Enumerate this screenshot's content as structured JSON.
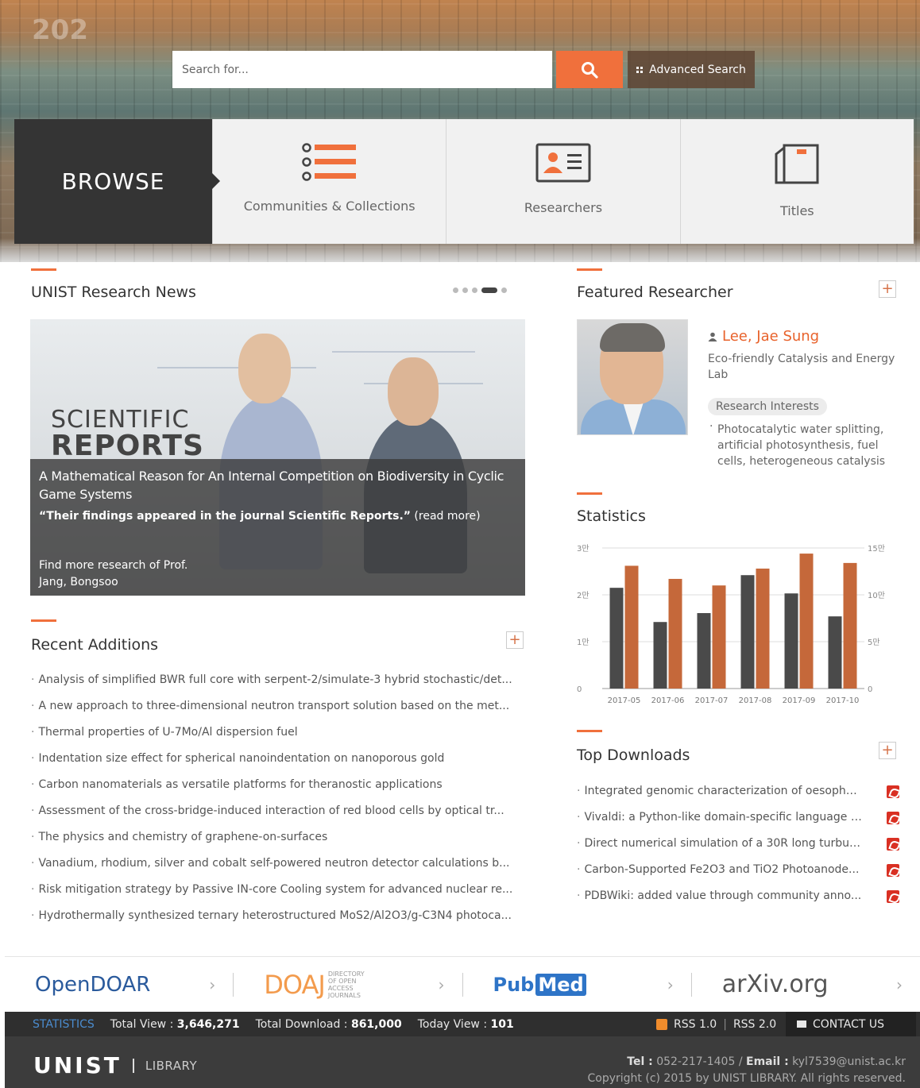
{
  "hero": {
    "decor_number": "202"
  },
  "search": {
    "placeholder": "Search for...",
    "advanced_label": "Advanced Search"
  },
  "browse": {
    "title": "BROWSE",
    "items": [
      {
        "label": "Communities & Collections",
        "icon": "list-icon"
      },
      {
        "label": "Researchers",
        "icon": "contact-card-icon"
      },
      {
        "label": "Titles",
        "icon": "book-icon"
      }
    ]
  },
  "news": {
    "title": "UNIST Research News",
    "slide_count": 5,
    "active_slide": 4,
    "logo_line1": "SCIENTIFIC",
    "logo_line2": "REPORTS",
    "headline": "A Mathematical Reason for An Internal Competition on Biodiversity in Cyclic Game Systems",
    "quote": "“Their findings appeared in the journal Scientific Reports.”",
    "read_more": "(read more)",
    "more_line1": "Find more research of Prof.",
    "more_line2": "Jang, Bongsoo"
  },
  "recent": {
    "title": "Recent Additions",
    "items": [
      "Analysis of simplified BWR full core with serpent-2/simulate-3 hybrid stochastic/det...",
      "A new approach to three-dimensional neutron transport solution based on the met...",
      "Thermal properties of U-7Mo/Al dispersion fuel",
      "Indentation size effect for spherical nanoindentation on nanoporous gold",
      "Carbon nanomaterials as versatile platforms for theranostic applications",
      "Assessment of the cross-bridge-induced interaction of red blood cells by optical tr...",
      "The physics and chemistry of graphene-on-surfaces",
      "Vanadium, rhodium, silver and cobalt self-powered neutron detector calculations b...",
      "Risk mitigation strategy by Passive IN-core Cooling system for advanced nuclear re...",
      "Hydrothermally synthesized ternary heterostructured MoS2/Al2O3/g-C3N4 photoca..."
    ]
  },
  "featured": {
    "title": "Featured Researcher",
    "name": "Lee, Jae Sung",
    "lab": "Eco-friendly Catalysis and Energy Lab",
    "interests_label": "Research Interests",
    "interests": "Photocatalytic water splitting, artificial photosynthesis, fuel cells, heterogeneous catalysis"
  },
  "statistics": {
    "title": "Statistics"
  },
  "chart_data": {
    "type": "bar",
    "categories": [
      "2017-05",
      "2017-06",
      "2017-07",
      "2017-08",
      "2017-09",
      "2017-10"
    ],
    "series": [
      {
        "values": [
          21500,
          14200,
          16100,
          24200,
          20300,
          15400
        ],
        "axis": "left",
        "color": "#4a4a4a"
      },
      {
        "values": [
          131000,
          117000,
          110000,
          128000,
          144000,
          134000
        ],
        "axis": "right",
        "color": "#c5683a"
      }
    ],
    "y_left_ticks": [
      "0",
      "1만",
      "2만",
      "3만"
    ],
    "y_left_range": [
      0,
      30000
    ],
    "y_right_ticks": [
      "0",
      "5만",
      "10만",
      "15만"
    ],
    "y_right_range": [
      0,
      150000
    ],
    "grid": true
  },
  "downloads": {
    "title": "Top Downloads",
    "items": [
      "Integrated genomic characterization of oesopha...",
      "Vivaldi: a Python-like domain-specific language f...",
      "Direct numerical simulation of a 30R long turbul...",
      "Carbon-Supported Fe2O3 and TiO2 Photoanode...",
      "PDBWiki: added value through community anno..."
    ]
  },
  "partners": {
    "opendoar_a": "Open",
    "opendoar_b": "DOAR",
    "doaj": "DOAJ",
    "doaj_sub": "DIRECTORY OF OPEN ACCESS JOURNALS",
    "pubmed_a": "Pub",
    "pubmed_b": "Med",
    "arxiv": "arXiv.org"
  },
  "statbar": {
    "label": "STATISTICS",
    "total_view_label": "Total View :",
    "total_view": "3,646,271",
    "total_download_label": "Total Download :",
    "total_download": "861,000",
    "today_view_label": "Today View :",
    "today_view": "101",
    "rss1": "RSS 1.0",
    "rss2": "RSS 2.0",
    "contact": "CONTACT US"
  },
  "footer": {
    "logo": "UNIST",
    "library": "LIBRARY",
    "tel_label": "Tel :",
    "tel": "052-217-1405",
    "email_label": "Email :",
    "email": "kyl7539@unist.ac.kr",
    "copyright": "Copyright (c) 2015 by UNIST LIBRARY. All rights reserved."
  }
}
